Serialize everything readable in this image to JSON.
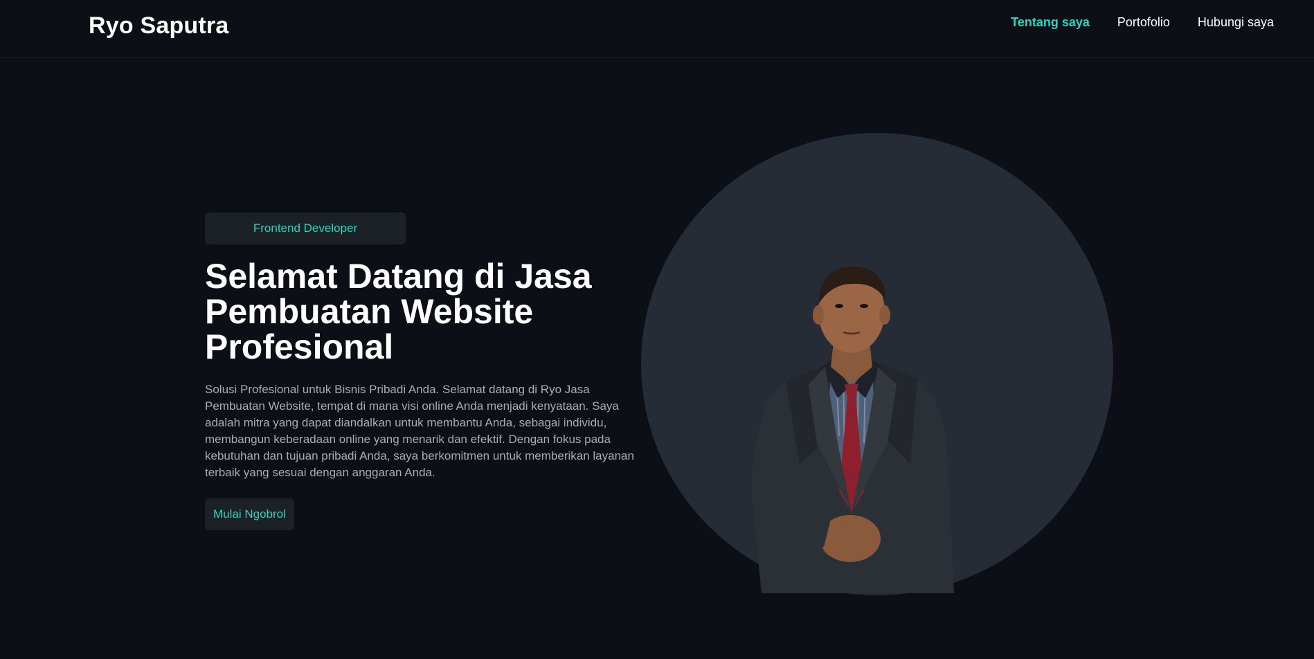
{
  "header": {
    "brand": "Ryo Saputra",
    "nav": [
      {
        "label": "Tentang saya",
        "active": true
      },
      {
        "label": "Portofolio",
        "active": false
      },
      {
        "label": "Hubungi saya",
        "active": false
      }
    ]
  },
  "hero": {
    "badge": "Frontend Developer",
    "title": "Selamat Datang di Jasa Pembuatan Website Profesional",
    "description": "Solusi Profesional untuk Bisnis Pribadi Anda. Selamat datang di Ryo Jasa Pembuatan Website, tempat di mana visi online Anda menjadi kenyataan. Saya adalah mitra yang dapat diandalkan untuk membantu Anda, sebagai individu, membangun keberadaan online yang menarik dan efektif. Dengan fokus pada kebutuhan dan tujuan pribadi Anda, saya berkomitmen untuk memberikan layanan terbaik yang sesuai dengan anggaran Anda.",
    "cta_label": "Mulai Ngobrol",
    "portrait_icon": "person-portrait"
  },
  "colors": {
    "background": "#0c0f16",
    "accent": "#2dd4bf",
    "surface": "#1c2127",
    "circle": "#252c36",
    "muted_text": "#a5adb8"
  }
}
